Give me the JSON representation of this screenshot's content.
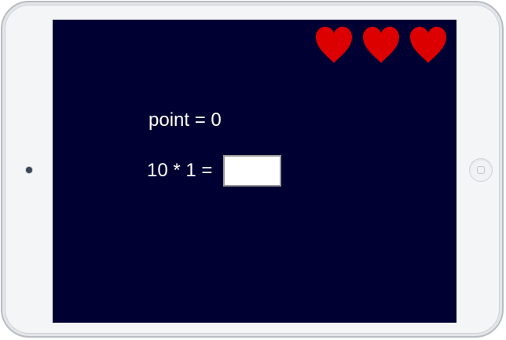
{
  "game": {
    "lives": [
      {
        "icon": "heart-icon",
        "color": "#dd0000"
      },
      {
        "icon": "heart-icon",
        "color": "#dd0000"
      },
      {
        "icon": "heart-icon",
        "color": "#dd0000"
      }
    ],
    "score_text": "point = 0",
    "question_text": "10 * 1 =",
    "answer_value": "",
    "screen_color": "#000033"
  }
}
